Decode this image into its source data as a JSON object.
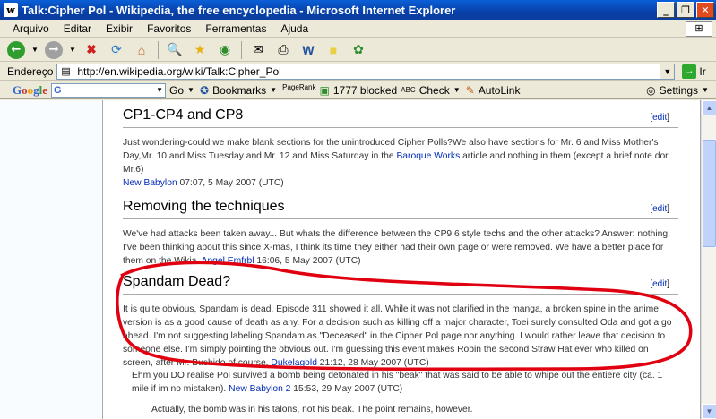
{
  "window": {
    "title": "Talk:Cipher Pol - Wikipedia, the free encyclopedia - Microsoft Internet Explorer",
    "icon_name": "ie-icon",
    "buttons": [
      "_",
      "❐",
      "✕"
    ]
  },
  "menu": [
    "Arquivo",
    "Editar",
    "Exibir",
    "Favoritos",
    "Ferramentas",
    "Ajuda"
  ],
  "address": {
    "label": "Endereço",
    "url": "http://en.wikipedia.org/wiki/Talk:Cipher_Pol",
    "go_label": "Ir"
  },
  "google_bar": {
    "logo": [
      "G",
      "o",
      "o",
      "g",
      "l",
      "e"
    ],
    "search_value": "G",
    "go": "Go",
    "bookmarks": "Bookmarks",
    "pagerank": "PageRank",
    "blocked": "1777 blocked",
    "check": "Check",
    "autolink": "AutoLink",
    "settings": "Settings"
  },
  "sections": [
    {
      "heading": "CP1-CP4 and CP8",
      "edit": "edit",
      "text": "Just wondering-could we make blank sections for the unintroduced Cipher Polls?We also have sections for Mr. 6 and Miss Mother's Day,Mr. 10 and Miss Tuesday and Mr. 12 and Miss Saturday in the ",
      "link1": "Baroque Works",
      "text2": " article and nothing in them (except a brief note dor Mr.6)",
      "sig_user": "New Babylon",
      "sig_time": " 07:07, 5 May 2007 (UTC)"
    },
    {
      "heading": "Removing the techniques",
      "edit": "edit",
      "text": "We've had attacks been taken away... But whats the difference between the CP9 6 style techs and the other attacks? Answer: nothing. I've been thinking about this since X-mas, I think its time they either had their own page or were removed. We have a better place for them on the Wikia. ",
      "sig_user": "Angel Emfrbl",
      "sig_time": " 16:06, 5 May 2007 (UTC)"
    },
    {
      "heading": "Spandam Dead?",
      "edit": "edit",
      "text": "It is quite obvious, Spandam is dead. Episode 311 showed it all. While it was not clarified in the manga, a broken spine in the anime version is as a good cause of death as any. For a decision such as killing off a major character, Toei surely consulted Oda and got a go ahead. I'm not suggesting labeling Spandam as \"Deceased\" in the Cipher Pol page nor anything. I would rather leave that decision to someone else. I'm simply pointing the obvious out. I'm guessing this event makes Robin the second Straw Hat ever who killed on screen, after Mr. Bushido of course. ",
      "sig_user": "Dukelagold",
      "sig_time": " 21:12, 28 May 2007 (UTC)",
      "reply1": "Ehm you DO realise Poi survived a bomb being detonated in his \"beak\" that was said to be able to whipe out the entiere city (ca. 1 mile if im no mistaken). ",
      "reply1_user": "New Babylon 2",
      "reply1_time": " 15:53, 29 May 2007 (UTC)",
      "reply2": "Actually, the bomb was in his talons, not his beak. The point remains, however."
    }
  ],
  "colors": {
    "link": "#002BB8",
    "annotation": "#E0000F",
    "titlebar": "#0A5FD8"
  }
}
